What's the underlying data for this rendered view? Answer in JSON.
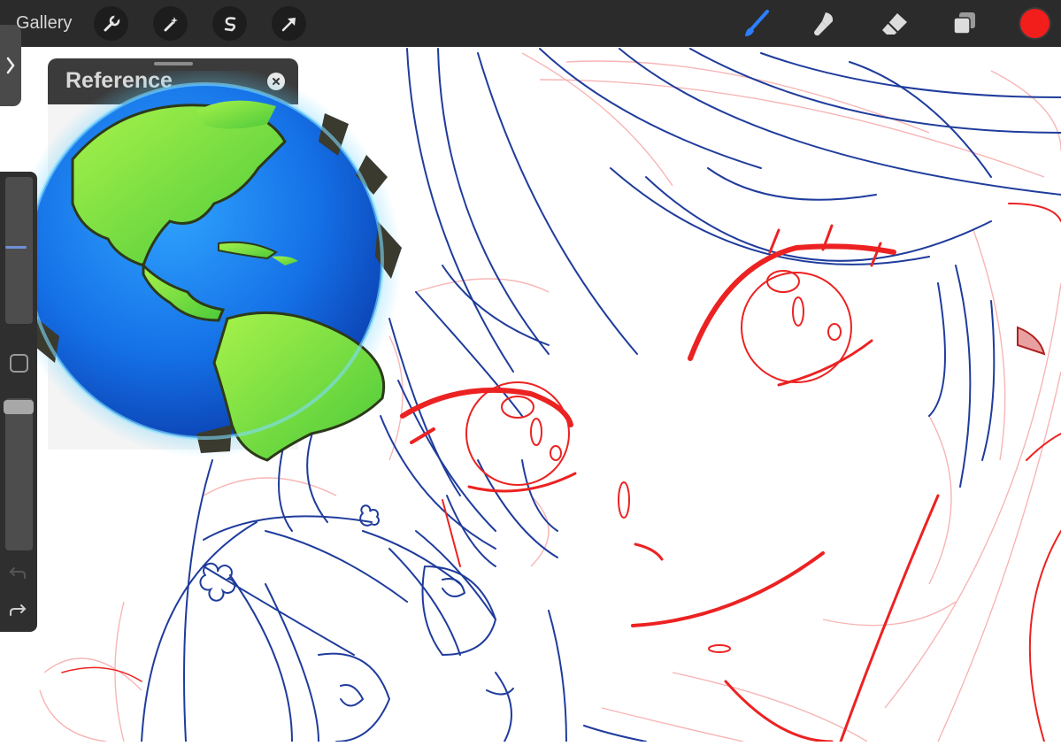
{
  "toolbar": {
    "gallery_label": "Gallery",
    "left_tools": [
      "wrench-icon",
      "magic-wand-icon",
      "selection-s-icon",
      "transform-arrow-icon"
    ],
    "right_tools": [
      "brush-icon",
      "smudge-icon",
      "eraser-icon",
      "layers-icon"
    ],
    "active_tool": "brush-icon",
    "current_color": "#f11e1c"
  },
  "sidebar": {
    "brush_size_level": 0.5,
    "opacity_level": 1.0,
    "items": [
      "brush-size-slider",
      "modify-button",
      "opacity-slider",
      "undo-icon",
      "redo-icon"
    ]
  },
  "reference_window": {
    "title": "Reference"
  },
  "canvas": {
    "sketch_colors": {
      "lineart": "#1e3a9a",
      "eyes_and_mouth": "#ee2222",
      "rough_sketch": "#f4a4a4"
    }
  }
}
